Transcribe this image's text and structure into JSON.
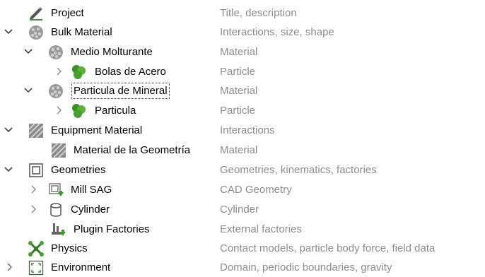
{
  "tree": [
    {
      "label": "Project",
      "description": "Title, description",
      "icon": "pencil-icon",
      "expander": "none"
    },
    {
      "label": "Bulk Material",
      "description": "Interactions, size, shape",
      "icon": "bulk-material-icon",
      "expander": "expanded"
    },
    {
      "label": "Medio Molturante",
      "description": "Material",
      "icon": "bulk-material-icon",
      "expander": "expanded"
    },
    {
      "label": "Bolas de Acero",
      "description": "Particle",
      "icon": "particle-icon",
      "expander": "collapsed"
    },
    {
      "label": "Particula de Mineral",
      "description": "Material",
      "icon": "bulk-material-icon",
      "expander": "expanded",
      "selected": true
    },
    {
      "label": "Particula",
      "description": "Particle",
      "icon": "particle-icon",
      "expander": "collapsed"
    },
    {
      "label": "Equipment Material",
      "description": "Interactions",
      "icon": "equipment-material-icon",
      "expander": "expanded"
    },
    {
      "label": "Material de la Geometría",
      "description": "Material",
      "icon": "equipment-material-icon",
      "expander": "none"
    },
    {
      "label": "Geometries",
      "description": "Geometries, kinematics, factories",
      "icon": "geometries-icon",
      "expander": "expanded"
    },
    {
      "label": "Mill SAG",
      "description": "CAD Geometry",
      "icon": "cad-geometry-icon",
      "expander": "collapsed"
    },
    {
      "label": "Cylinder",
      "description": "Cylinder",
      "icon": "cylinder-icon",
      "expander": "collapsed"
    },
    {
      "label": "Plugin Factories",
      "description": "External factories",
      "icon": "plugin-factory-icon",
      "expander": "none"
    },
    {
      "label": "Physics",
      "description": "Contact models, particle body force, field data",
      "icon": "physics-icon",
      "expander": "none"
    },
    {
      "label": "Environment",
      "description": "Domain, periodic boundaries, gravity",
      "icon": "environment-icon",
      "expander": "collapsed"
    }
  ],
  "colors": {
    "description_text": "#8c8c8c",
    "particle_green": "#4aa02c",
    "pencil_green": "#3f8f35"
  }
}
